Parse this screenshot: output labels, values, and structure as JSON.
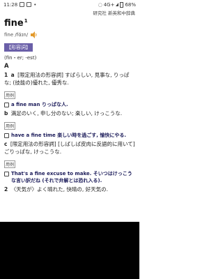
{
  "status_bar": {
    "time": "11:28",
    "network": "4G+",
    "battery": "68%"
  },
  "source_label": "研究社 新英和中辞典",
  "entry": {
    "headword": "fine",
    "superscript": "1",
    "pronunciation": "fine /fάɪn/",
    "pos": "【形容詞】",
    "forms": "(fin・er; -est)",
    "section": "A",
    "senses": [
      {
        "num": "1",
        "letter": "a",
        "text": "[限定用法の形容詞] すばらしい, 見事な, りっぱな; (技能の)優れた, 優秀な.",
        "example_tag": "用例",
        "example": "a fine man りっぱな人."
      },
      {
        "num": "",
        "letter": "b",
        "text": "満足のいく, 申し分のない; 楽しい, けっこうな.",
        "example_tag": "用例",
        "example": "have a fine time 楽しい時を過ごす, 愉快にやる."
      },
      {
        "num": "",
        "letter": "c",
        "text": "[限定用法の形容詞] [しばしば皮肉に反語的に用いて] ごりっぱな, けっこうな.",
        "example_tag": "用例",
        "example": "That's a fine excuse to make. そいつはけっこうな言い訳だね (それで弁解とは恐れ入る)."
      },
      {
        "num": "2",
        "letter": "",
        "text": "〈天気が〉よく晴れた, 快晴の, 好天気の.",
        "example_tag": "",
        "example": ""
      }
    ]
  },
  "icons": {
    "speaker": "speaker-icon",
    "notification": "notification-icon",
    "signal": "signal-icon",
    "battery": "battery-icon"
  }
}
